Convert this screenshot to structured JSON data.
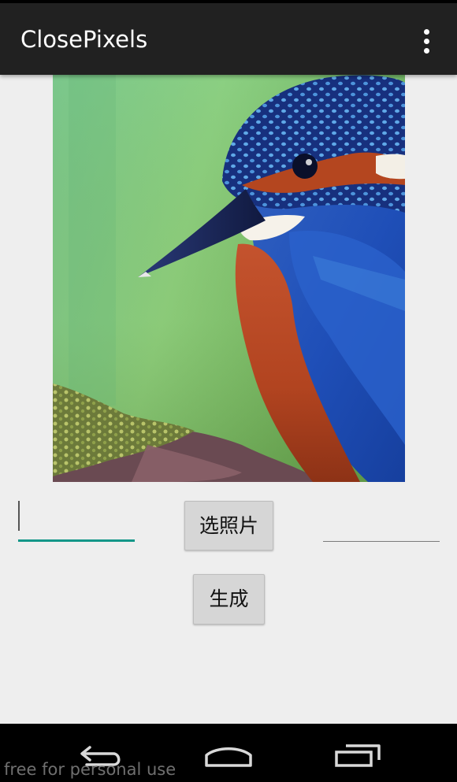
{
  "app_bar": {
    "title": "ClosePixels",
    "menu_icon": "overflow-menu-icon"
  },
  "image": {
    "subject": "kingfisher-photo"
  },
  "inputs": {
    "left_value": "",
    "right_value": ""
  },
  "buttons": {
    "select_photo": "选照片",
    "generate": "生成"
  },
  "nav": {
    "back_icon": "back-icon",
    "home_icon": "home-icon",
    "recents_icon": "recent-apps-icon"
  },
  "watermark": "free for personal use",
  "colors": {
    "action_bar": "#212121",
    "background": "#eeeeee",
    "accent": "#139688",
    "nav_bar": "#000000"
  }
}
